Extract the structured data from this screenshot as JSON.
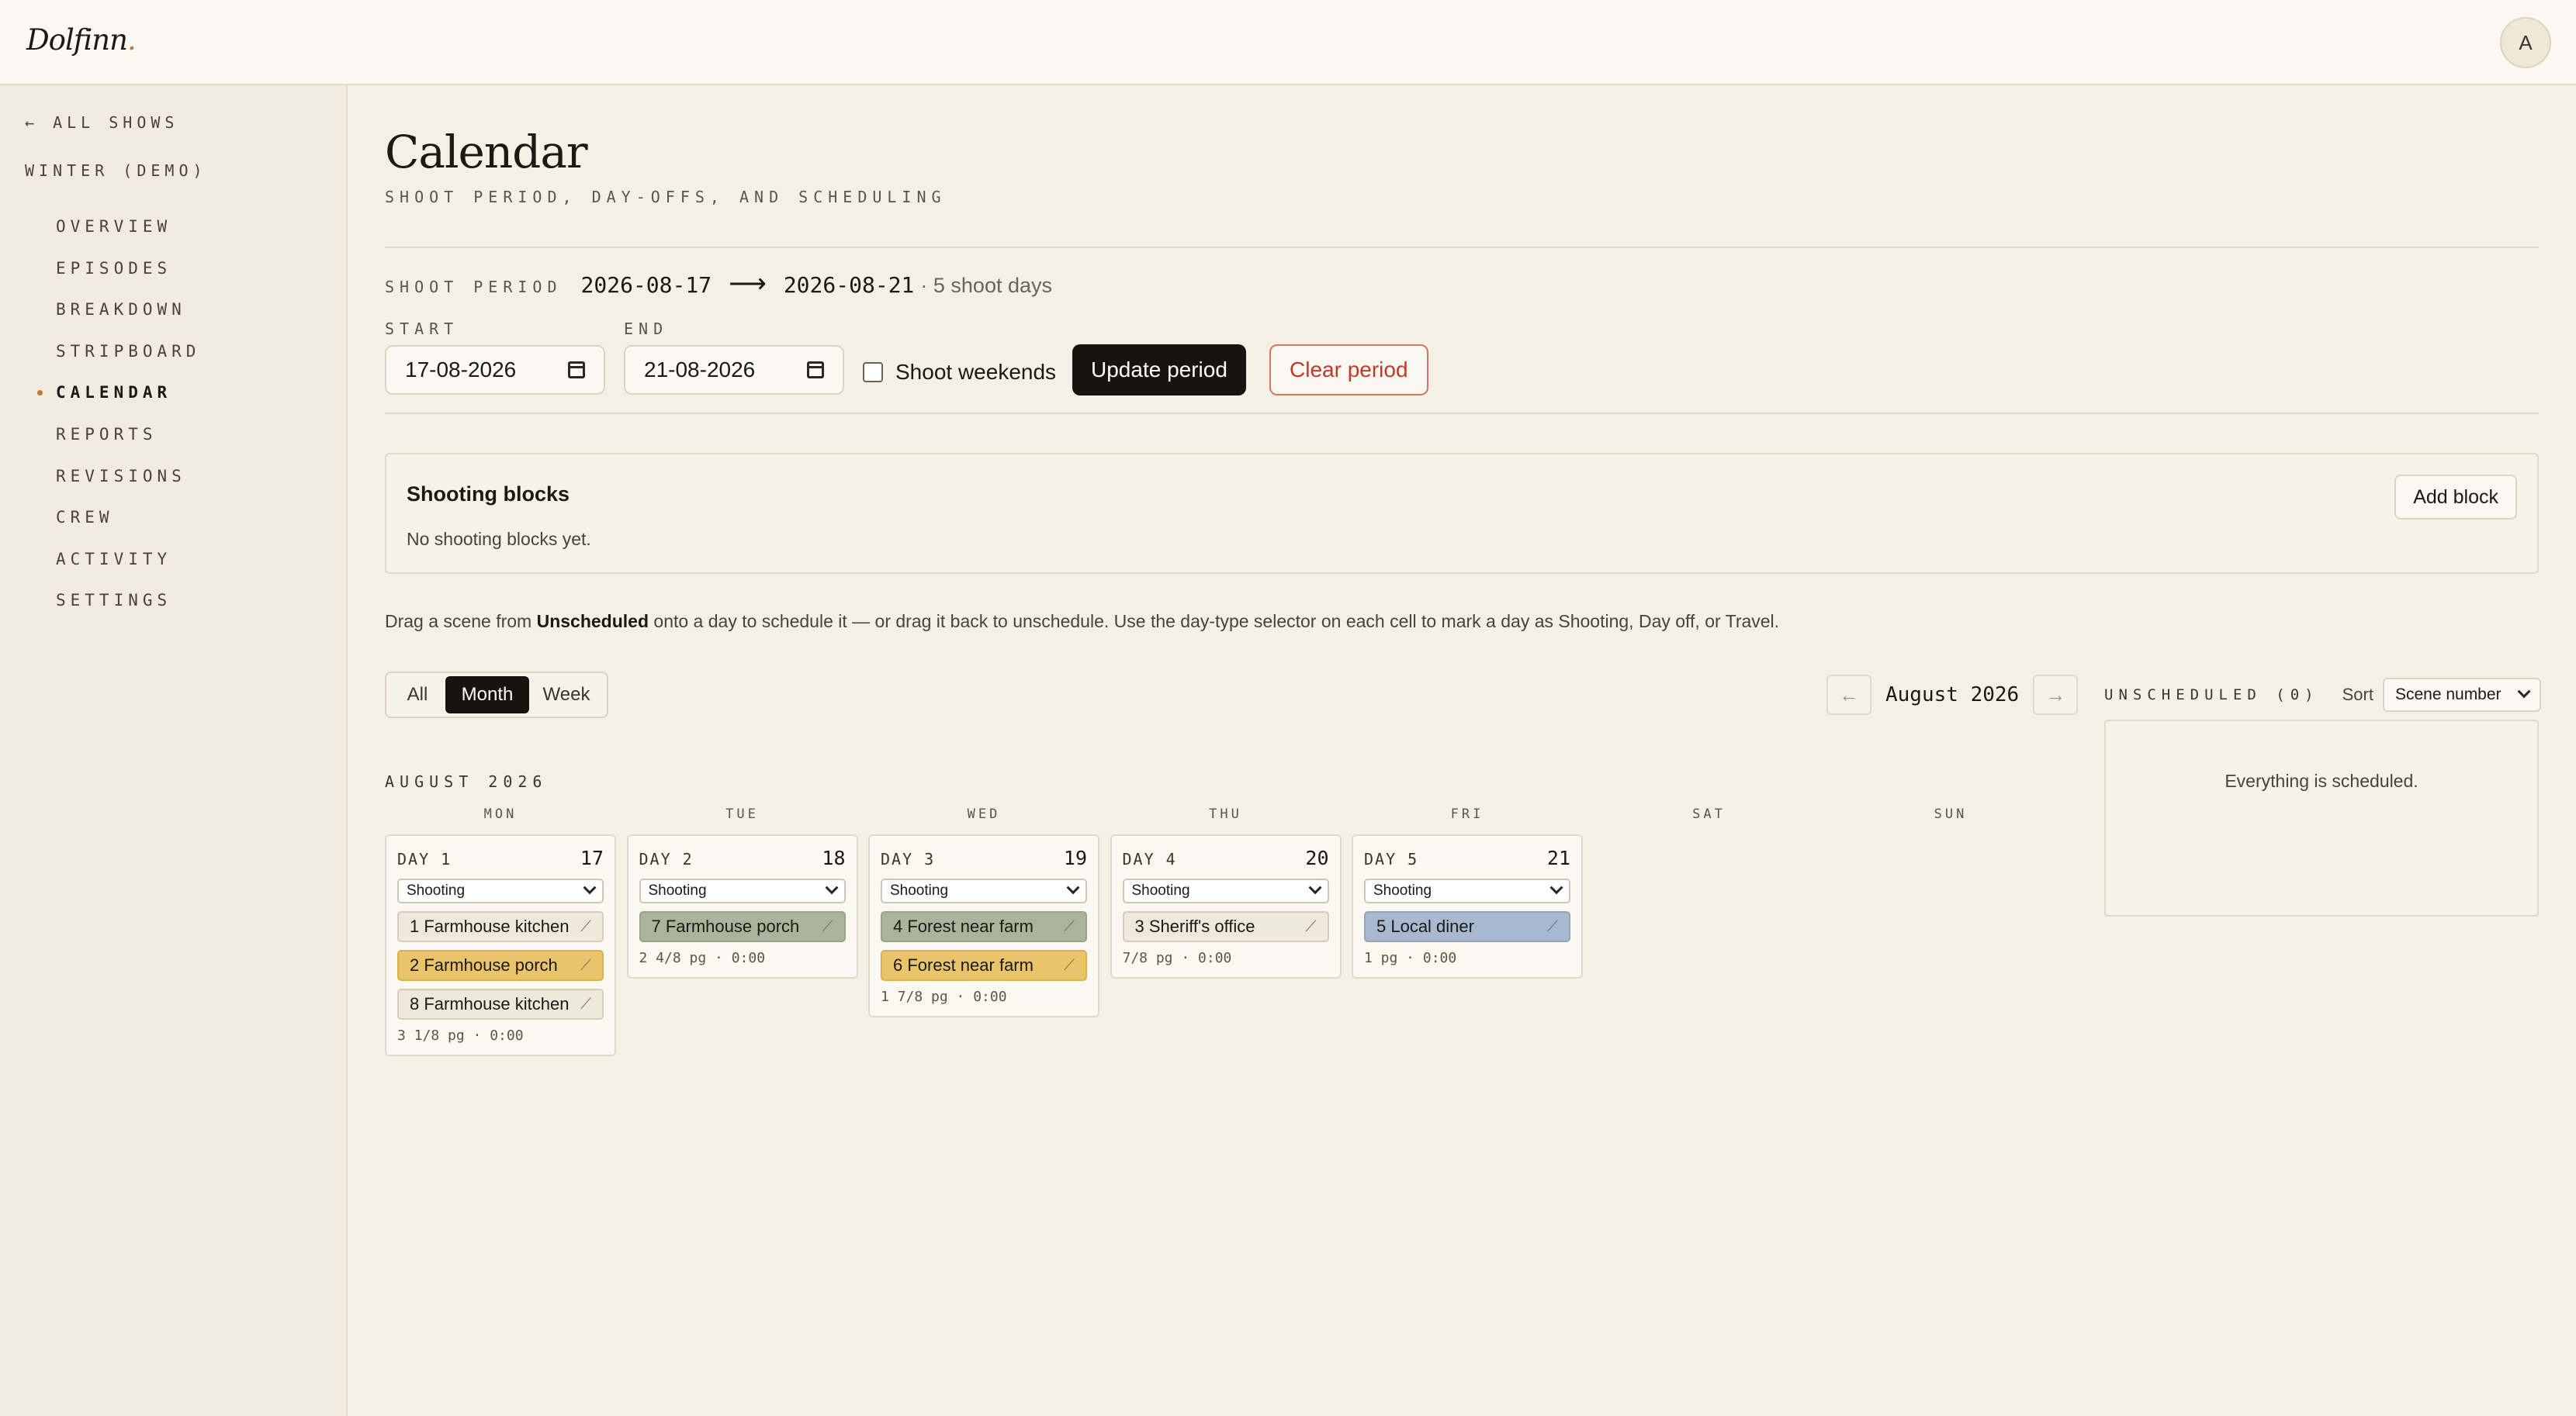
{
  "app": {
    "logo": "Dolfinn",
    "logo_dot": ".",
    "avatar_initial": "A"
  },
  "sidebar": {
    "back_label": "← ALL SHOWS",
    "show_title": "WINTER (DEMO)",
    "items": [
      {
        "label": "OVERVIEW",
        "active": false
      },
      {
        "label": "EPISODES",
        "active": false
      },
      {
        "label": "BREAKDOWN",
        "active": false
      },
      {
        "label": "STRIPBOARD",
        "active": false
      },
      {
        "label": "CALENDAR",
        "active": true
      },
      {
        "label": "REPORTS",
        "active": false
      },
      {
        "label": "REVISIONS",
        "active": false
      },
      {
        "label": "CREW",
        "active": false
      },
      {
        "label": "ACTIVITY",
        "active": false
      },
      {
        "label": "SETTINGS",
        "active": false
      }
    ]
  },
  "header": {
    "title": "Calendar",
    "subtitle": "SHOOT PERIOD, DAY-OFFS, AND SCHEDULING"
  },
  "period": {
    "label": "SHOOT PERIOD",
    "start_display": "2026-08-17",
    "arrow": "⟶",
    "end_display": "2026-08-21",
    "days_summary": "· 5 shoot days",
    "start_label": "START",
    "end_label": "END",
    "start_value": "17-08-2026",
    "end_value": "21-08-2026",
    "weekends_label": "Shoot weekends",
    "weekends_checked": false,
    "update_button": "Update period",
    "clear_button": "Clear period"
  },
  "blocks": {
    "title": "Shooting blocks",
    "empty": "No shooting blocks yet.",
    "add_button": "Add block"
  },
  "hint": {
    "before": "Drag a scene from ",
    "strong": "Unscheduled",
    "after": " onto a day to schedule it — or drag it back to unschedule. Use the day-type selector on each cell to mark a day as Shooting, Day off, or Travel."
  },
  "view_toggle": {
    "options": [
      "All",
      "Month",
      "Week"
    ],
    "active": "Month"
  },
  "month_nav": {
    "prev": "←",
    "label": "August 2026",
    "next": "→"
  },
  "calendar": {
    "month_heading": "AUGUST 2026",
    "weekdays": [
      "MON",
      "TUE",
      "WED",
      "THU",
      "FRI",
      "SAT",
      "SUN"
    ],
    "days": [
      {
        "label": "DAY 1",
        "date": "17",
        "type": "Shooting",
        "scenes": [
          {
            "text": "1 Farmhouse kitchen",
            "color": "beige"
          },
          {
            "text": "2 Farmhouse porch",
            "color": "yellow"
          },
          {
            "text": "8 Farmhouse kitchen",
            "color": "beige"
          }
        ],
        "footer": "3 1/8 pg · 0:00"
      },
      {
        "label": "DAY 2",
        "date": "18",
        "type": "Shooting",
        "scenes": [
          {
            "text": "7 Farmhouse porch",
            "color": "green"
          }
        ],
        "footer": "2 4/8 pg · 0:00"
      },
      {
        "label": "DAY 3",
        "date": "19",
        "type": "Shooting",
        "scenes": [
          {
            "text": "4 Forest near farm",
            "color": "green"
          },
          {
            "text": "6 Forest near farm",
            "color": "yellow"
          }
        ],
        "footer": "1 7/8 pg · 0:00"
      },
      {
        "label": "DAY 4",
        "date": "20",
        "type": "Shooting",
        "scenes": [
          {
            "text": "3 Sheriff's office",
            "color": "beige"
          }
        ],
        "footer": "7/8 pg · 0:00"
      },
      {
        "label": "DAY 5",
        "date": "21",
        "type": "Shooting",
        "scenes": [
          {
            "text": "5 Local diner",
            "color": "blue"
          }
        ],
        "footer": "1 pg · 0:00"
      }
    ],
    "drag_glyph": "⟋"
  },
  "unscheduled": {
    "title": "UNSCHEDULED (0)",
    "sort_label": "Sort",
    "sort_value": "Scene number",
    "empty": "Everything is scheduled."
  },
  "colors": {
    "background": "#f5f0e6",
    "accent_dot": "#c0783a",
    "primary_button": "#17130f",
    "danger": "#c0392b",
    "scene_beige": "#efe9dc",
    "scene_yellow": "#e9c46a",
    "scene_green": "#a9b59b",
    "scene_blue": "#a7b8cf"
  },
  "icons": {
    "back": "arrow-left-icon",
    "calendar": "calendar-icon",
    "chevron": "chevron-down-icon",
    "drag": "drag-handle-icon"
  }
}
